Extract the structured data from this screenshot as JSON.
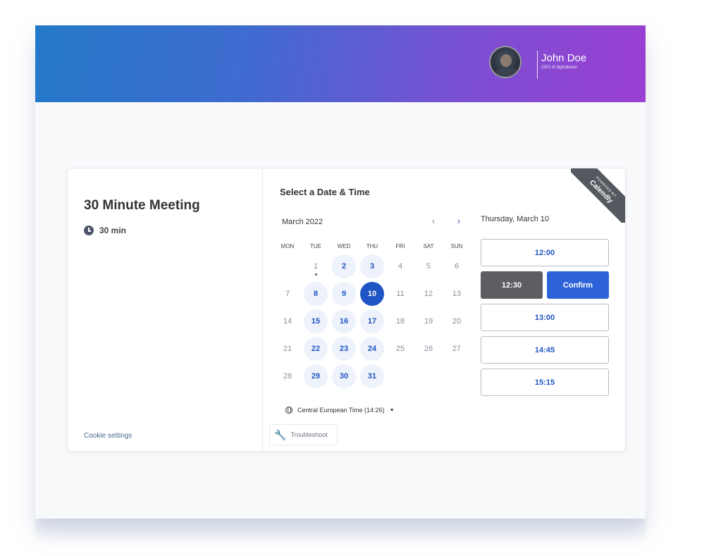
{
  "host": {
    "name": "John Doe",
    "title": "CEO of digitalleven"
  },
  "event": {
    "title": "30 Minute Meeting",
    "duration": "30 min"
  },
  "footer": {
    "cookie_settings": "Cookie settings",
    "troubleshoot": "Troubleshoot"
  },
  "branding": {
    "ribbon_top": "POWERED BY",
    "ribbon_name": "Calendly"
  },
  "scheduler": {
    "heading": "Select a Date & Time",
    "month": "March 2022",
    "prev_icon": "‹",
    "next_icon": "›",
    "weekdays": [
      "MON",
      "TUE",
      "WED",
      "THU",
      "FRI",
      "SAT",
      "SUN"
    ],
    "days": [
      {
        "label": "",
        "state": "empty"
      },
      {
        "label": "1",
        "state": "today"
      },
      {
        "label": "2",
        "state": "avail"
      },
      {
        "label": "3",
        "state": "avail"
      },
      {
        "label": "4",
        "state": "off"
      },
      {
        "label": "5",
        "state": "off"
      },
      {
        "label": "6",
        "state": "off"
      },
      {
        "label": "7",
        "state": "off"
      },
      {
        "label": "8",
        "state": "avail"
      },
      {
        "label": "9",
        "state": "avail"
      },
      {
        "label": "10",
        "state": "sel"
      },
      {
        "label": "11",
        "state": "off"
      },
      {
        "label": "12",
        "state": "off"
      },
      {
        "label": "13",
        "state": "off"
      },
      {
        "label": "14",
        "state": "off"
      },
      {
        "label": "15",
        "state": "avail"
      },
      {
        "label": "16",
        "state": "avail"
      },
      {
        "label": "17",
        "state": "avail"
      },
      {
        "label": "18",
        "state": "off"
      },
      {
        "label": "19",
        "state": "off"
      },
      {
        "label": "20",
        "state": "off"
      },
      {
        "label": "21",
        "state": "off"
      },
      {
        "label": "22",
        "state": "avail"
      },
      {
        "label": "23",
        "state": "avail"
      },
      {
        "label": "24",
        "state": "avail"
      },
      {
        "label": "25",
        "state": "off"
      },
      {
        "label": "26",
        "state": "off"
      },
      {
        "label": "27",
        "state": "off"
      },
      {
        "label": "28",
        "state": "off"
      },
      {
        "label": "29",
        "state": "avail"
      },
      {
        "label": "30",
        "state": "avail"
      },
      {
        "label": "31",
        "state": "avail"
      }
    ],
    "timezone": "Central European Time (14:26)",
    "selected_date": "Thursday, March 10",
    "slot_1": "12:00",
    "slot_selected": "12:30",
    "confirm": "Confirm",
    "slot_3": "13:00",
    "slot_4": "14:45",
    "slot_5": "15:15"
  },
  "colors": {
    "accent": "#1f55c4",
    "banner_start": "#2479c9",
    "banner_end": "#9a3fd2",
    "selected_slot": "#5d5e61"
  }
}
